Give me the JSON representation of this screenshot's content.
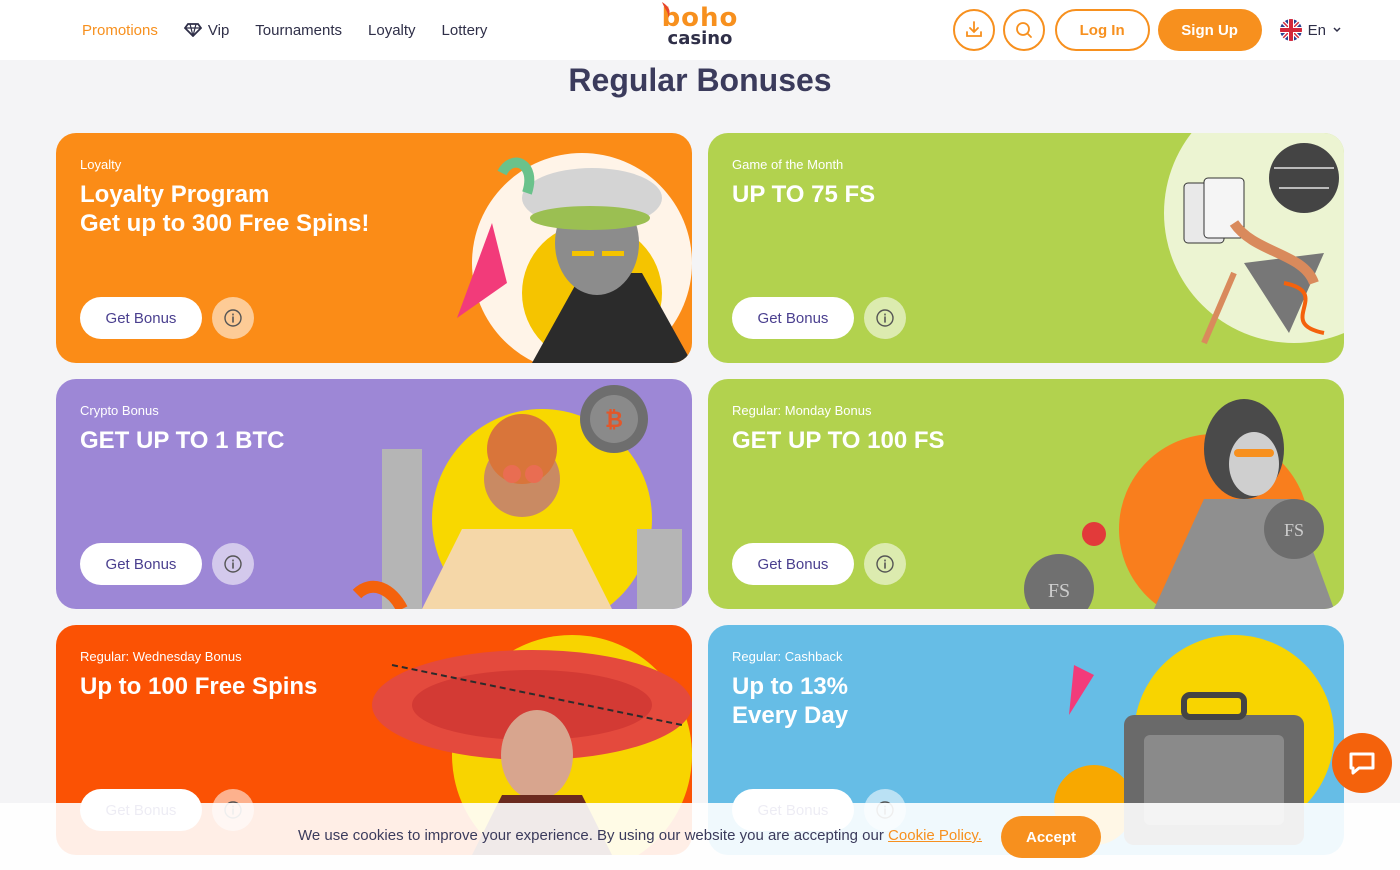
{
  "header": {
    "nav": [
      {
        "label": "Promotions",
        "active": true
      },
      {
        "label": "Vip",
        "icon": "diamond-icon"
      },
      {
        "label": "Tournaments"
      },
      {
        "label": "Loyalty"
      },
      {
        "label": "Lottery"
      }
    ],
    "logo_top": "boho",
    "logo_bottom": "casino",
    "download_icon": "download-icon",
    "search_icon": "search-icon",
    "login_label": "Log In",
    "signup_label": "Sign Up",
    "language": "En",
    "flag_icon": "uk-flag-icon",
    "chevron_icon": "chevron-down-icon"
  },
  "page_title": "Regular Bonuses",
  "cards": [
    {
      "tag": "Loyalty",
      "headline_1": "Loyalty Program",
      "headline_2": "Get up to 300 Free Spins!",
      "button": "Get Bonus",
      "color": "#fb8c17"
    },
    {
      "tag": "Game of the Month",
      "headline_1": "UP TO 75 FS",
      "headline_2": "",
      "button": "Get Bonus",
      "color": "#b2d24e"
    },
    {
      "tag": "Crypto Bonus",
      "headline_1": "GET UP TO 1 BTC",
      "headline_2": "",
      "button": "Get Bonus",
      "color": "#9d87d6"
    },
    {
      "tag": "Regular: Monday Bonus",
      "headline_1": "GET UP TO 100 FS",
      "headline_2": "",
      "button": "Get Bonus",
      "color": "#b2d24e"
    },
    {
      "tag": "Regular: Wednesday Bonus",
      "headline_1": "Up to 100 Free Spins",
      "headline_2": "",
      "button": "Get Bonus",
      "color": "#fb5204"
    },
    {
      "tag": "Regular: Cashback",
      "headline_1": "Up to 13%",
      "headline_2": "Every Day",
      "button": "Get Bonus",
      "color": "#66bde6"
    }
  ],
  "cookie": {
    "text": "We use cookies to improve your experience. By using our website you are accepting our ",
    "link": "Cookie Policy.",
    "accept": "Accept"
  },
  "colors": {
    "accent": "#f7901e",
    "chat": "#f4620c"
  }
}
